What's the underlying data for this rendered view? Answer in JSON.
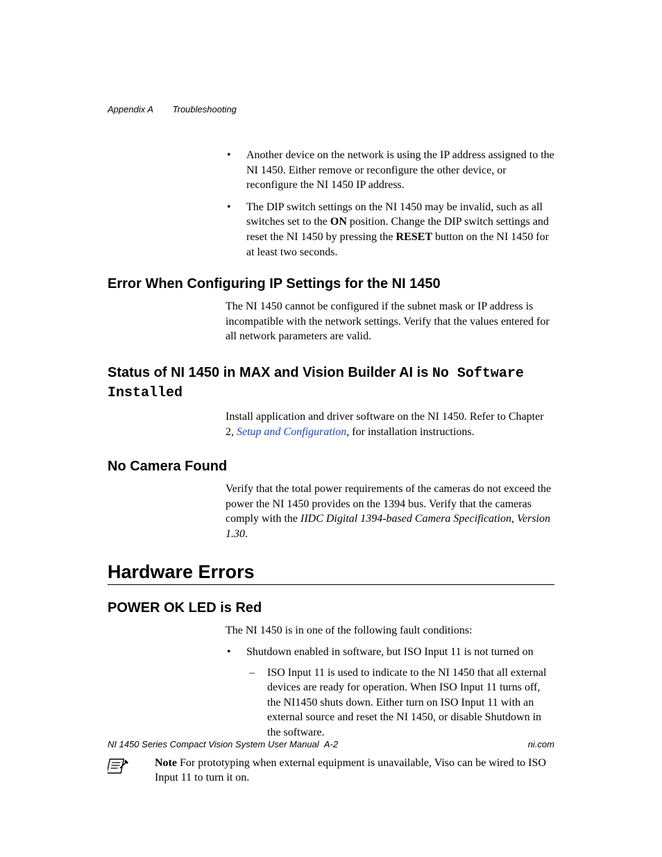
{
  "header": {
    "appendix": "Appendix A",
    "title": "Troubleshooting"
  },
  "intro_bullets": {
    "b1_pre": "Another device on the network is using the IP address assigned to the NI 1450. Either remove or reconfigure the other device, or reconfigure the NI 1450 IP address.",
    "b2_part1": "The DIP switch settings on the NI 1450 may be invalid, such as all switches set to the ",
    "b2_bold1": "ON",
    "b2_part2": " position. Change the DIP switch settings and reset the NI 1450 by pressing the ",
    "b2_bold2": "RESET",
    "b2_part3": " button on the NI 1450 for at least two seconds."
  },
  "sec1": {
    "heading": "Error When Configuring IP Settings for the NI 1450",
    "body": "The NI 1450 cannot be configured if the subnet mask or IP address is incompatible with the network settings. Verify that the values entered for all network parameters are valid."
  },
  "sec2": {
    "heading_part1": "Status of NI 1450 in MAX and Vision Builder AI is ",
    "heading_mono": "No Software Installed",
    "body_part1": "Install application and driver software on the NI 1450. Refer to Chapter  2, ",
    "body_link": "Setup and Configuration",
    "body_part2": ", for installation instructions."
  },
  "sec3": {
    "heading": "No Camera Found",
    "body_part1": "Verify that the total power requirements of the cameras do not exceed the power the NI 1450 provides on the 1394 bus. Verify that the cameras comply with the ",
    "body_italic": "IIDC Digital 1394-based Camera Specification, Version 1.30",
    "body_part2": "."
  },
  "h1": "Hardware Errors",
  "sec4": {
    "heading": "POWER OK LED is Red",
    "intro": "The NI 1450 is in one of the following fault conditions:",
    "bullet1": "Shutdown enabled in software, but ISO Input 11 is not turned on",
    "sub1": "ISO Input 11 is used to indicate to the NI 1450 that all external devices are ready for operation. When ISO Input 11 turns off, the NI1450 shuts down. Either turn on ISO Input 11 with an external source and reset the NI 1450, or disable Shutdown in the software."
  },
  "note": {
    "label": "Note",
    "body": "   For prototyping when external equipment is unavailable, Viso can be wired to ISO Input 11 to turn it on."
  },
  "footer": {
    "left": "NI 1450 Series Compact Vision System User Manual",
    "center": "A-2",
    "right": "ni.com"
  }
}
